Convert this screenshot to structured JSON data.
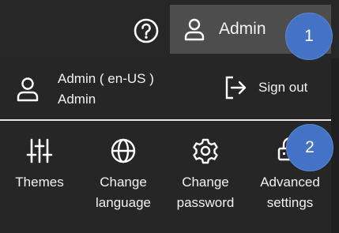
{
  "header": {
    "user_button_label": "Admin"
  },
  "profile": {
    "name_locale": "Admin ( en-US )",
    "role": "Admin"
  },
  "signout": {
    "label": "Sign out"
  },
  "actions": [
    {
      "label": "Themes",
      "icon": "sliders-icon"
    },
    {
      "label": "Change\nlanguage",
      "icon": "globe-icon"
    },
    {
      "label": "Change\npassword",
      "icon": "gear-icon"
    },
    {
      "label": "Advanced\nsettings",
      "icon": "advanced-settings-icon"
    }
  ],
  "badges": [
    "1",
    "2"
  ],
  "colors": {
    "background": "#272727",
    "user_button_bg": "#4d4d4d",
    "badge": "#4472c4",
    "text": "#ffffff"
  }
}
